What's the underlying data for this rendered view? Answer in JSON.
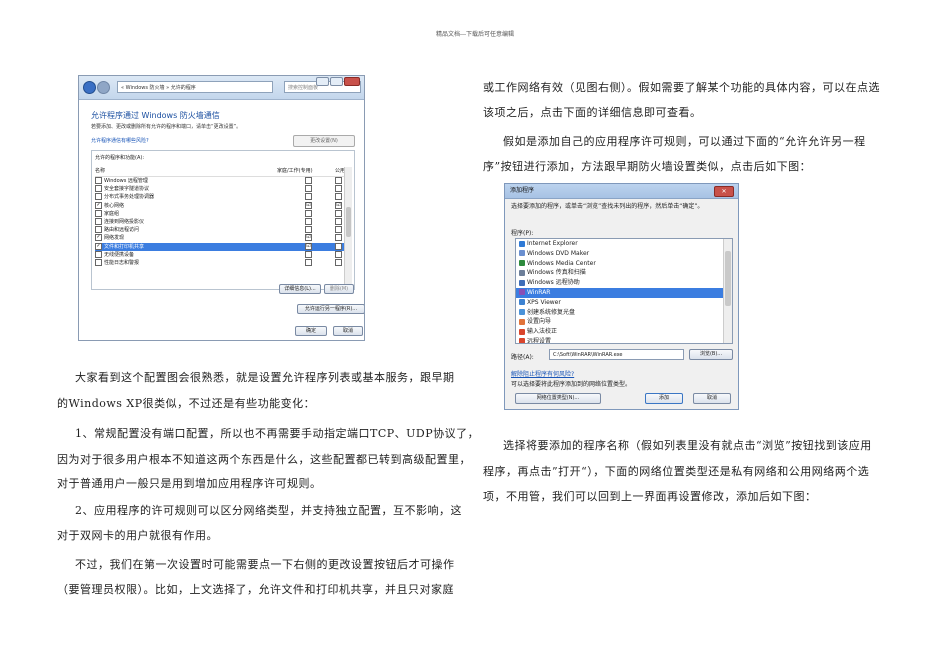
{
  "header": {
    "text": "精品文档---下载后可任意编辑"
  },
  "screenshot1": {
    "address": "« Windows 防火墙 » 允许的程序",
    "search_placeholder": "搜索控制面板",
    "title": "允许程序通过 Windows 防火墙通信",
    "description": "若要添加、更改或删除所有允许的程序和端口，请单击“更改设置”。",
    "risk_link": "允许程序通信有哪些风险?",
    "change_settings": "更改设置(N)",
    "list_label": "允许的程序和功能(A):",
    "col_name": "名称",
    "col_home": "家庭/工作(专用)",
    "col_public": "公用",
    "rows": [
      {
        "name": "Windows 远程管理",
        "home": "",
        "public": ""
      },
      {
        "name": "安全套接字隧道协议",
        "home": "",
        "public": ""
      },
      {
        "name": "分布式事务处理协调器",
        "home": "",
        "public": ""
      },
      {
        "name": "核心网络",
        "home": "☑",
        "public": "☑"
      },
      {
        "name": "家庭组",
        "home": "",
        "public": ""
      },
      {
        "name": "连接到网络投影仪",
        "home": "",
        "public": ""
      },
      {
        "name": "路由和远程访问",
        "home": "",
        "public": ""
      },
      {
        "name": "网络发现",
        "home": "☑",
        "public": ""
      },
      {
        "name": "文件和打印机共享",
        "home": "☑",
        "public": ""
      },
      {
        "name": "无线便携设备",
        "home": "",
        "public": ""
      },
      {
        "name": "性能日志和警报",
        "home": "",
        "public": ""
      }
    ],
    "details_button": "详细信息(L)...",
    "remove_button": "删除(M)",
    "allow_other_button": "允许运行另一程序(R)...",
    "ok_button": "确定",
    "cancel_button": "取消"
  },
  "screenshot2": {
    "title": "添加程序",
    "close": "✕",
    "intro": "选择要添加的程序，或单击“浏览”查找未列出的程序，然后单击“确定”。",
    "programs_label": "程序(P):",
    "items": [
      {
        "name": "Internet Explorer",
        "color": "#2f7ad6"
      },
      {
        "name": "Windows DVD Maker",
        "color": "#6a8fd0"
      },
      {
        "name": "Windows Media Center",
        "color": "#2d8a3d"
      },
      {
        "name": "Windows 传真和扫描",
        "color": "#6d7f99"
      },
      {
        "name": "Windows 远程协助",
        "color": "#3e6db8"
      },
      {
        "name": "WinRAR",
        "color": "#8a4fb5"
      },
      {
        "name": "XPS Viewer",
        "color": "#3d82d1"
      },
      {
        "name": "创建系统修复光盘",
        "color": "#4a92d8"
      },
      {
        "name": "设置向导",
        "color": "#e0733a"
      },
      {
        "name": "输入法校正",
        "color": "#d9452c"
      },
      {
        "name": "远程设置",
        "color": "#d9452c"
      }
    ],
    "selected_index": 5,
    "path_label": "路径(A):",
    "path_value": "C:\\Soft\\WinRAR\\WinRAR.exe",
    "browse_button": "浏览(B)...",
    "risk_link": "解除阻止程序有何风险?",
    "hint": "可以选择要将此程序添加到的网络位置类型。",
    "network_button": "网络位置类型(N)...",
    "add_button": "添加",
    "cancel_button": "取消"
  },
  "left_column": {
    "p1a": "大家看到这个配置图会很熟悉，就是设置允许程序列表或基本服务，跟早期",
    "p1b": "的Windows XP很类似，不过还是有些功能变化：",
    "p2a": "1、常规配置没有端口配置，所以也不再需要手动指定端口TCP、UDP协议了，",
    "p2b": "因为对于很多用户根本不知道这两个东西是什么，这些配置都已转到高级配置里，",
    "p2c": "对于普通用户一般只是用到增加应用程序许可规则。",
    "p3a": "2、应用程序的许可规则可以区分网络类型，并支持独立配置，互不影响，这",
    "p3b": "对于双网卡的用户就很有作用。",
    "p4a": "不过，我们在第一次设置时可能需要点一下右侧的更改设置按钮后才可操作",
    "p4b": "（要管理员权限）。比如，上文选择了，允许文件和打印机共享，并且只对家庭"
  },
  "right_column": {
    "p1a": "或工作网络有效（见图右侧）。假如需要了解某个功能的具体内容，可以在点选",
    "p1b": "该项之后，点击下面的详细信息即可查看。",
    "p2a": "假如是添加自己的应用程序许可规则，可以通过下面的“允许允许另一程",
    "p2b": "序”按钮进行添加，方法跟早期防火墙设置类似，点击后如下图：",
    "p3a": "选择将要添加的程序名称（假如列表里没有就点击“浏览”按钮找到该应用",
    "p3b": "程序，再点击”打开“），下面的网络位置类型还是私有网络和公用网络两个选",
    "p3c": "项，不用管，我们可以回到上一界面再设置修改，添加后如下图："
  }
}
